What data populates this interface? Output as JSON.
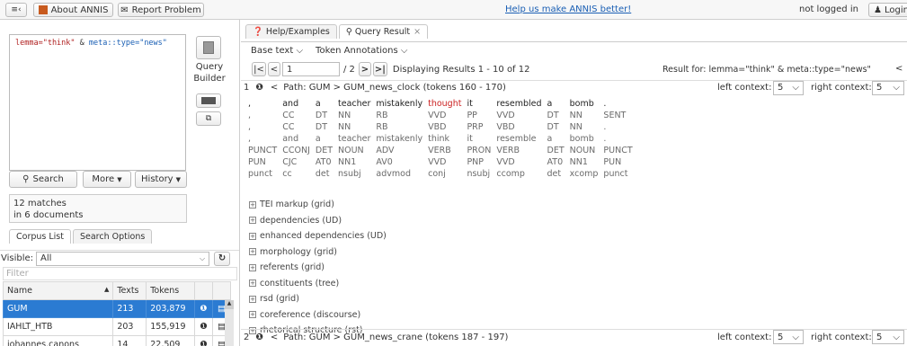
{
  "topbar": {
    "menu_icon": "≡‹",
    "about_label": "About ANNIS",
    "report_label": "Report Problem",
    "help_link": "Help us make ANNIS better!",
    "login_status": "not logged in",
    "login_label": "Login"
  },
  "query": {
    "line1": "lemma=\"think\"",
    "amp": "&",
    "line2": "meta::type=\"news\"",
    "builder_label": "Query\nBuilder",
    "search_label": "Search",
    "more_label": "More",
    "history_label": "History",
    "matches_line1": "12 matches",
    "matches_line2": "in 6 documents"
  },
  "corpus_panel": {
    "tabs": [
      "Corpus List",
      "Search Options"
    ],
    "visible_label": "Visible:",
    "visible_value": "All",
    "filter_placeholder": "Filter",
    "columns": [
      "Name",
      "Texts",
      "Tokens"
    ],
    "rows": [
      {
        "name": "GUM",
        "texts": "213",
        "tokens": "203,879"
      },
      {
        "name": "IAHLT_HTB",
        "texts": "203",
        "tokens": "155,919"
      },
      {
        "name": "johannes.canons",
        "texts": "14",
        "tokens": "22,509"
      }
    ]
  },
  "results": {
    "tabs": [
      "Help/Examples",
      "Query Result"
    ],
    "base_text_label": "Base text",
    "token_ann_label": "Token Annotations",
    "page_value": "1",
    "page_total": "/ 2",
    "displaying": "Displaying Results 1 - 10 of 12",
    "result_for": "Result for: lemma=\"think\" & meta::type=\"news\"",
    "match1": {
      "num": "1",
      "path": "Path: GUM > GUM_news_clock (tokens 160 - 170)",
      "left_context_label": "left context:",
      "left_context": "5",
      "right_context_label": "right context:",
      "right_context": "5"
    },
    "match2": {
      "num": "2",
      "path": "Path: GUM > GUM_news_crane (tokens 187 - 197)",
      "left_context_label": "left context:",
      "left_context": "5",
      "right_context_label": "right context:",
      "right_context": "5"
    },
    "token_rows": [
      [
        ",",
        "and",
        "a",
        "teacher",
        "mistakenly",
        "thought",
        "it",
        "resembled",
        "a",
        "bomb",
        "."
      ],
      [
        ",",
        "CC",
        "DT",
        "NN",
        "RB",
        "VVD",
        "PP",
        "VVD",
        "DT",
        "NN",
        "SENT"
      ],
      [
        ",",
        "CC",
        "DT",
        "NN",
        "RB",
        "VBD",
        "PRP",
        "VBD",
        "DT",
        "NN",
        "."
      ],
      [
        ",",
        "and",
        "a",
        "teacher",
        "mistakenly",
        "think",
        "it",
        "resemble",
        "a",
        "bomb",
        "."
      ],
      [
        "PUNCT",
        "CCONJ",
        "DET",
        "NOUN",
        "ADV",
        "VERB",
        "PRON",
        "VERB",
        "DET",
        "NOUN",
        "PUNCT"
      ],
      [
        "PUN",
        "CJC",
        "AT0",
        "NN1",
        "AV0",
        "VVD",
        "PNP",
        "VVD",
        "AT0",
        "NN1",
        "PUN"
      ],
      [
        "punct",
        "cc",
        "det",
        "nsubj",
        "advmod",
        "conj",
        "nsubj",
        "ccomp",
        "det",
        "xcomp",
        "punct"
      ]
    ],
    "layers": [
      "TEI markup (grid)",
      "dependencies (UD)",
      "enhanced dependencies (UD)",
      "morphology (grid)",
      "referents (grid)",
      "constituents (tree)",
      "rsd (grid)",
      "coreference (discourse)",
      "rhetorical structure (rst)"
    ]
  },
  "colors": {
    "accent": "#2b7bd2",
    "hit": "#cc2222",
    "link": "#1a5fb4"
  }
}
